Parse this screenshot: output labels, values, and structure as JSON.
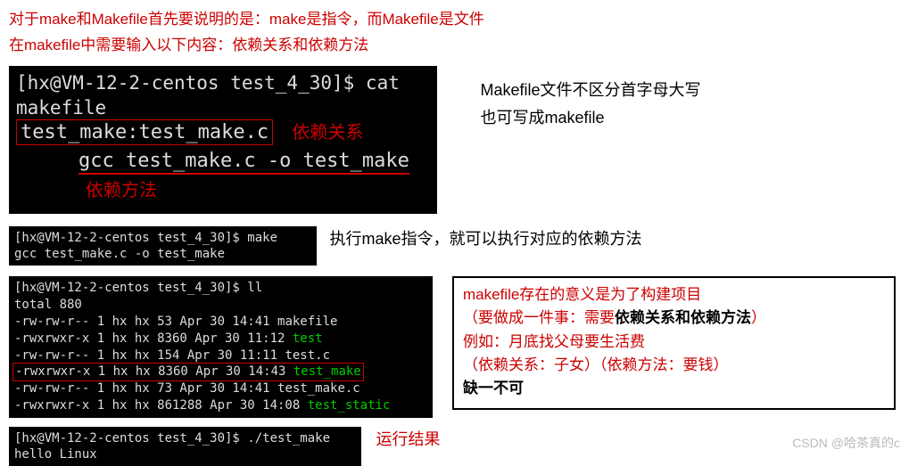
{
  "intro": {
    "line1": "对于make和Makefile首先要说明的是：make是指令，而Makefile是文件",
    "line2": "在makefile中需要输入以下内容：依赖关系和依赖方法"
  },
  "term1": {
    "prompt": "[hx@VM-12-2-centos test_4_30]$ cat makefile",
    "dep_rule": "test_make:test_make.c",
    "dep_anno": "依赖关系",
    "method_cmd": "gcc test_make.c -o test_make",
    "method_anno": "依赖方法"
  },
  "note1": {
    "l1": "Makefile文件不区分首字母大写",
    "l2": "也可写成makefile"
  },
  "term2": {
    "l1": "[hx@VM-12-2-centos test_4_30]$ make",
    "l2": "gcc test_make.c -o test_make"
  },
  "note2": "执行make指令，就可以执行对应的依赖方法",
  "term3": {
    "prompt": "[hx@VM-12-2-centos test_4_30]$ ll",
    "total": "total 880",
    "rows": [
      {
        "pre": "-rw-rw-r-- 1 hx hx     53 Apr 30 14:41 ",
        "name": "makefile",
        "green": false,
        "hl": false
      },
      {
        "pre": "-rwxrwxr-x 1 hx hx   8360 Apr 30 11:12 ",
        "name": "test",
        "green": true,
        "hl": false
      },
      {
        "pre": "-rw-rw-r-- 1 hx hx    154 Apr 30 11:11 ",
        "name": "test.c",
        "green": false,
        "hl": false
      },
      {
        "pre": "-rwxrwxr-x 1 hx hx   8360 Apr 30 14:43 ",
        "name": "test_make",
        "green": true,
        "hl": true
      },
      {
        "pre": "-rw-rw-r-- 1 hx hx     73 Apr 30 14:41 ",
        "name": "test_make.c",
        "green": false,
        "hl": false
      },
      {
        "pre": "-rwxrwxr-x 1 hx hx 861288 Apr 30 14:08 ",
        "name": "test_static",
        "green": true,
        "hl": false
      }
    ]
  },
  "callout": {
    "l1a": "makefile存在的意义是为了构建项目",
    "l2a": "（要做成一件事：需要",
    "l2b": "依赖关系和依赖方法",
    "l2c": "）",
    "l3": "例如：月底找父母要生活费",
    "l4": "（依赖关系：子女）（依赖方法：要钱）",
    "l5": "缺一不可"
  },
  "term4": {
    "l1": "[hx@VM-12-2-centos test_4_30]$ ./test_make",
    "l2": "hello Linux"
  },
  "note4": "运行结果",
  "watermark": "CSDN @哈茶真的c"
}
